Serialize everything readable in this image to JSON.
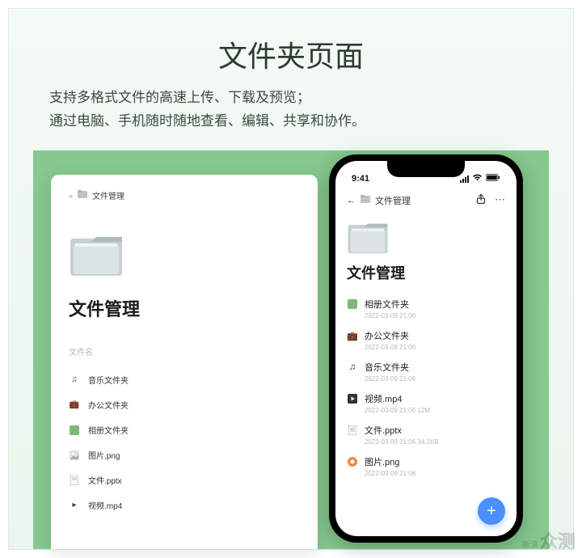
{
  "page": {
    "title": "文件夹页面",
    "description_line1": "支持多格式文件的高速上传、下载及预览；",
    "description_line2": "通过电脑、手机随时随地查看、编辑、共享和协作。"
  },
  "desktop": {
    "breadcrumb_expand": "»",
    "breadcrumb_label": "文件管理",
    "title": "文件管理",
    "column_header": "文件名",
    "rows": [
      {
        "icon": "music-icon",
        "name": "音乐文件夹"
      },
      {
        "icon": "briefcase-icon",
        "name": "办公文件夹"
      },
      {
        "icon": "album-icon",
        "name": "相册文件夹"
      },
      {
        "icon": "image-icon",
        "name": "图片.png"
      },
      {
        "icon": "document-icon",
        "name": "文件.pptx"
      },
      {
        "icon": "video-icon",
        "name": "视频.mp4"
      }
    ]
  },
  "phone": {
    "status_time": "9:41",
    "breadcrumb_label": "文件管理",
    "title": "文件管理",
    "rows": [
      {
        "icon": "album-icon",
        "name": "相册文件夹",
        "meta": "2022-03-09 21:06"
      },
      {
        "icon": "briefcase-icon",
        "name": "办公文件夹",
        "meta": "2022-03-09 21:06"
      },
      {
        "icon": "music-icon",
        "name": "音乐文件夹",
        "meta": "2022-03-09 21:06"
      },
      {
        "icon": "video-icon",
        "name": "视频.mp4",
        "meta": "2022-03-09 21:06   12M"
      },
      {
        "icon": "document-icon",
        "name": "文件.pptx",
        "meta": "2022-03-09 21:06   34.2KB"
      },
      {
        "icon": "image-icon",
        "name": "图片.png",
        "meta": "2022-03-09 21:06"
      }
    ],
    "fab_label": "+"
  },
  "watermark": {
    "small": "新浪",
    "big": "众测"
  }
}
